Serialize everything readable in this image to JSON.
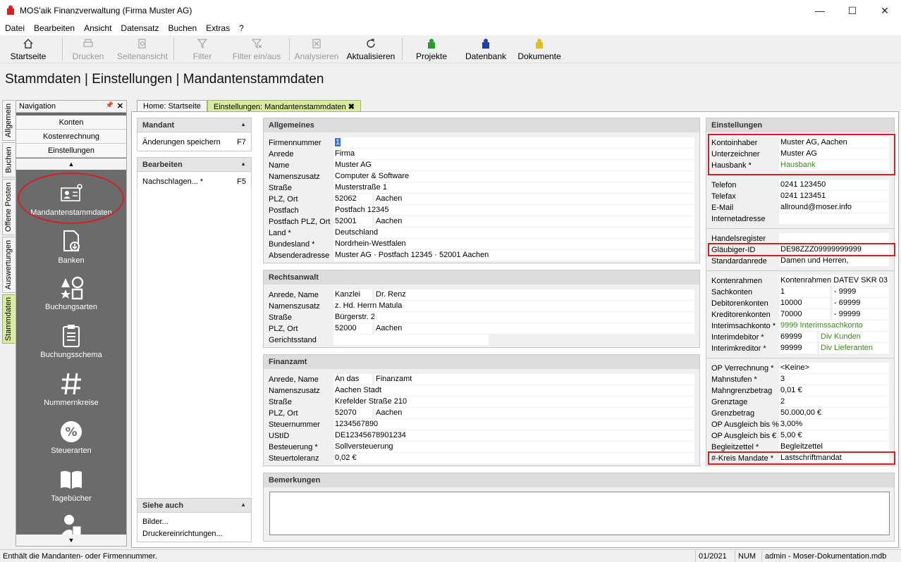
{
  "window": {
    "title": "MOS'aik Finanzverwaltung (Firma Muster AG)",
    "minimize": "—",
    "maximize": "☐",
    "close": "✕"
  },
  "menu": [
    "Datei",
    "Bearbeiten",
    "Ansicht",
    "Datensatz",
    "Buchen",
    "Extras",
    "?"
  ],
  "toolbar": {
    "startseite": "Startseite",
    "drucken": "Drucken",
    "seitenansicht": "Seitenansicht",
    "filter": "Filter",
    "filter_einaus": "Filter ein/aus",
    "analysieren": "Analysieren",
    "aktualisieren": "Aktualisieren",
    "projekte": "Projekte",
    "datenbank": "Datenbank",
    "dokumente": "Dokumente"
  },
  "page_title": "Stammdaten | Einstellungen | Mandantenstammdaten",
  "vertical_tabs": [
    "Allgemein",
    "Buchen",
    "Offene Posten",
    "Auswertungen",
    "Stammdaten"
  ],
  "navigation": {
    "title": "Navigation",
    "pin": "📌",
    "close": "✕",
    "categories": [
      "Konten",
      "Kostenrechnung",
      "Einstellungen"
    ],
    "scroll_up": "▲",
    "scroll_down": "▼",
    "items": [
      "Mandantenstammdaten",
      "Banken",
      "Buchungsarten",
      "Buchungsschema",
      "Nummernkreise",
      "Steuerarten",
      "Tagebücher"
    ]
  },
  "tabs": {
    "home": "Home: Startseite",
    "active": "Einstellungen: Mandantenstammdaten",
    "close": "✖"
  },
  "side": {
    "mandant_title": "Mandant",
    "mandant_action": "Änderungen speichern",
    "mandant_key": "F7",
    "bearbeiten_title": "Bearbeiten",
    "bearbeiten_action": "Nachschlagen... *",
    "bearbeiten_key": "F5",
    "siehe_title": "Siehe auch",
    "siehe_items": [
      "Bilder...",
      "Druckereinrichtungen..."
    ],
    "arrow": "▲"
  },
  "allgemeines": {
    "title": "Allgemeines",
    "firmennummer_label": "Firmennummer",
    "firmennummer": "1",
    "anrede_label": "Anrede",
    "anrede": "Firma",
    "name_label": "Name",
    "name": "Muster AG",
    "namenszusatz_label": "Namenszusatz",
    "namenszusatz": "Computer & Software",
    "strasse_label": "Straße",
    "strasse": "Musterstraße 1",
    "plzort_label": "PLZ, Ort",
    "plz": "52062",
    "ort": "Aachen",
    "postfach_label": "Postfach",
    "postfach": "Postfach 12345",
    "postfachplz_label": "Postfach PLZ, Ort",
    "postfachplz": "52001",
    "postfachort": "Aachen",
    "land_label": "Land *",
    "land": "Deutschland",
    "bundesland_label": "Bundesland *",
    "bundesland": "Nordrhein-Westfalen",
    "absender_label": "Absenderadresse",
    "absender": "Muster AG · Postfach 12345 · 52001 Aachen"
  },
  "rechtsanwalt": {
    "title": "Rechtsanwalt",
    "anrede_label": "Anrede, Name",
    "anrede": "Kanzlei",
    "name": "Dr. Renz",
    "namenszusatz_label": "Namenszusatz",
    "namenszusatz": "z. Hd. Herrn Matula",
    "strasse_label": "Straße",
    "strasse": "Bürgerstr. 2",
    "plzort_label": "PLZ, Ort",
    "plz": "52000",
    "ort": "Aachen",
    "gerichtsstand_label": "Gerichtsstand",
    "gerichtsstand": ""
  },
  "finanzamt": {
    "title": "Finanzamt",
    "anrede_label": "Anrede, Name",
    "anrede": "An das",
    "name": "Finanzamt",
    "namenszusatz_label": "Namenszusatz",
    "namenszusatz": "Aachen Stadt",
    "strasse_label": "Straße",
    "strasse": "Krefelder Straße 210",
    "plzort_label": "PLZ, Ort",
    "plz": "52070",
    "ort": "Aachen",
    "steuernummer_label": "Steuernummer",
    "steuernummer": "1234567890",
    "ustid_label": "UStID",
    "ustid": "DE12345678901234",
    "besteuerung_label": "Besteuerung *",
    "besteuerung": "Sollversteuerung",
    "steuertoleranz_label": "Steuertoleranz",
    "steuertoleranz": "0,02 €"
  },
  "bemerkungen": {
    "title": "Bemerkungen",
    "text": ""
  },
  "einstellungen": {
    "title": "Einstellungen",
    "kontoinhaber_label": "Kontoinhaber",
    "kontoinhaber": "Muster AG, Aachen",
    "unterzeichner_label": "Unterzeichner",
    "unterzeichner": "Muster AG",
    "hausbank_label": "Hausbank *",
    "hausbank": "Hausbank",
    "telefon_label": "Telefon",
    "telefon": "0241 123450",
    "telefax_label": "Telefax",
    "telefax": "0241 123451",
    "email_label": "E-Mail",
    "email": "allround@moser.info",
    "internet_label": "Internetadresse",
    "internet": "",
    "handelsregister_label": "Handelsregister",
    "handelsregister": "",
    "glaeubiger_label": "Gläubiger-ID",
    "glaeubiger": "DE98ZZZ09999999999",
    "standardanrede_label": "Standardanrede",
    "standardanrede": "Damen und Herren,",
    "kontenrahmen_label": "Kontenrahmen",
    "kontenrahmen": "Kontenrahmen DATEV SKR 03",
    "sachkonten_label": "Sachkonten",
    "sachkonten_from": "1",
    "sachkonten_to": "- 9999",
    "debitoren_label": "Debitorenkonten",
    "debitoren_from": "10000",
    "debitoren_to": "- 69999",
    "kreditoren_label": "Kreditorenkonten",
    "kreditoren_from": "70000",
    "kreditoren_to": "- 99999",
    "interimsachkonto_label": "Interimsachkonto *",
    "interimsachkonto": "9999 Interimssachkonto",
    "interimdebitor_label": "Interimdebitor *",
    "interimdebitor": "69999",
    "interimdebitor_name": "Div Kunden",
    "interimkreditor_label": "Interimkreditor *",
    "interimkreditor": "99999",
    "interimkreditor_name": "Div Lieferanten",
    "opverrechnung_label": "OP Verrechnung *",
    "opverrechnung": "<Keine>",
    "mahnstufen_label": "Mahnstufen *",
    "mahnstufen": "3",
    "mahngrenz_label": "Mahngrenzbetrag",
    "mahngrenz": "0,01 €",
    "grenztage_label": "Grenztage",
    "grenztage": "2",
    "grenzbetrag_label": "Grenzbetrag",
    "grenzbetrag": "50.000,00 €",
    "opausgleichp_label": "OP Ausgleich bis %",
    "opausgleichp": "3,00%",
    "opausgleiche_label": "OP Ausgleich bis €",
    "opausgleiche": "5,00 €",
    "begleitzettel_label": "Begleitzettel *",
    "begleitzettel": "Begleitzettel",
    "kreis_label": "#-Kreis Mandate *",
    "kreis": "Lastschriftmandat"
  },
  "status": {
    "hint": "Enthält die Mandanten- oder Firmennummer.",
    "period": "01/2021",
    "num": "NUM",
    "db": "admin - Moser-Dokumentation.mdb"
  },
  "colors": {
    "accent_green": "#d9ec9e",
    "highlight_red": "#d42020",
    "nav_bg": "#6b6b6b"
  }
}
